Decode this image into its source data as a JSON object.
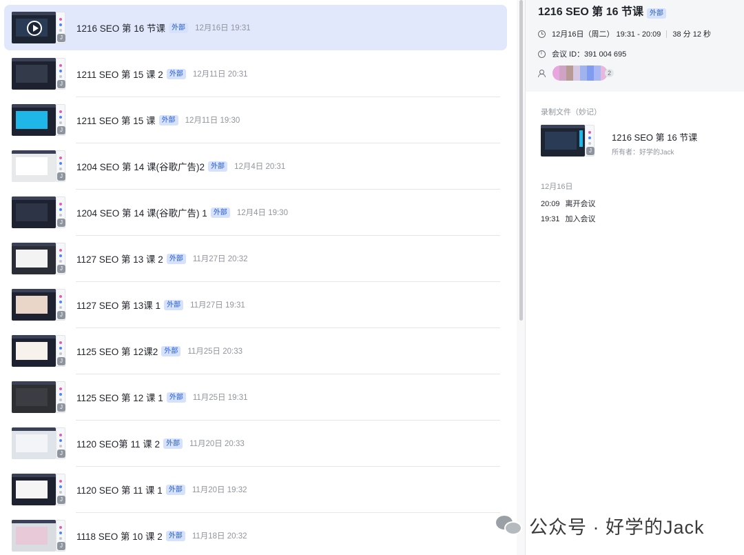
{
  "meetings": [
    {
      "title": "1216 SEO 第 16 节课",
      "tag": "外部",
      "time": "12月16日 19:31",
      "selected": true,
      "thumb_color": "#1d2432",
      "content_color": "#2a3b55"
    },
    {
      "title": "1211 SEO 第 15 课 2",
      "tag": "外部",
      "time": "12月11日 20:31",
      "selected": false,
      "thumb_color": "#1e2230",
      "content_color": "#333a4a"
    },
    {
      "title": "1211 SEO 第 15 课",
      "tag": "外部",
      "time": "12月11日 19:30",
      "selected": false,
      "thumb_color": "#1e2230",
      "content_color": "#1fb6e8"
    },
    {
      "title": "1204 SEO 第 14 课(谷歌广告)2",
      "tag": "外部",
      "time": "12月4日 20:31",
      "selected": false,
      "thumb_color": "#e8e9eb",
      "content_color": "#ffffff"
    },
    {
      "title": "1204 SEO 第 14 课(谷歌广告) 1",
      "tag": "外部",
      "time": "12月4日 19:30",
      "selected": false,
      "thumb_color": "#1e2230",
      "content_color": "#2c3446"
    },
    {
      "title": "1127 SEO 第 13 课 2",
      "tag": "外部",
      "time": "11月27日 20:32",
      "selected": false,
      "thumb_color": "#2a2d35",
      "content_color": "#f3f3f3"
    },
    {
      "title": "1127 SEO 第 13课 1",
      "tag": "外部",
      "time": "11月27日 19:31",
      "selected": false,
      "thumb_color": "#1e2230",
      "content_color": "#e9d6c8"
    },
    {
      "title": "1125 SEO 第 12课2",
      "tag": "外部",
      "time": "11月25日 20:33",
      "selected": false,
      "thumb_color": "#1e2230",
      "content_color": "#f7f3ec"
    },
    {
      "title": "1125 SEO 第 12 课 1",
      "tag": "外部",
      "time": "11月25日 19:31",
      "selected": false,
      "thumb_color": "#2d2f33",
      "content_color": "#3b3d42"
    },
    {
      "title": "1120 SEO第 11 课 2",
      "tag": "外部",
      "time": "11月20日 20:33",
      "selected": false,
      "thumb_color": "#dfe3ea",
      "content_color": "#f2f4f7"
    },
    {
      "title": "1120 SEO 第 11 课 1",
      "tag": "外部",
      "time": "11月20日 19:32",
      "selected": false,
      "thumb_color": "#1e2230",
      "content_color": "#f5f5f5"
    },
    {
      "title": "1118 SEO 第 10 课 2",
      "tag": "外部",
      "time": "11月18日 20:32",
      "selected": false,
      "thumb_color": "#d9dce1",
      "content_color": "#e8c9d8"
    }
  ],
  "detail": {
    "title": "1216 SEO 第 16 节课",
    "tag": "外部",
    "datetime": "12月16日（周二） 19:31 - 20:09",
    "duration": "38 分 12 秒",
    "meeting_id": "会议 ID：391 004 695",
    "participant_count": "2",
    "recording_label": "录制文件（妙记）",
    "recording_title": "1216 SEO 第 16 节课",
    "recording_owner": "所有者：好学的Jack",
    "log_date": "12月16日",
    "log": [
      {
        "time": "20:09",
        "event": "离开会议"
      },
      {
        "time": "19:31",
        "event": "加入会议"
      }
    ]
  },
  "watermark": "公众号 · 好学的Jack",
  "colors": {
    "accent": "#245bdb",
    "selected_bg": "#e1e8fb",
    "tag_bg": "#d6e2fb"
  }
}
